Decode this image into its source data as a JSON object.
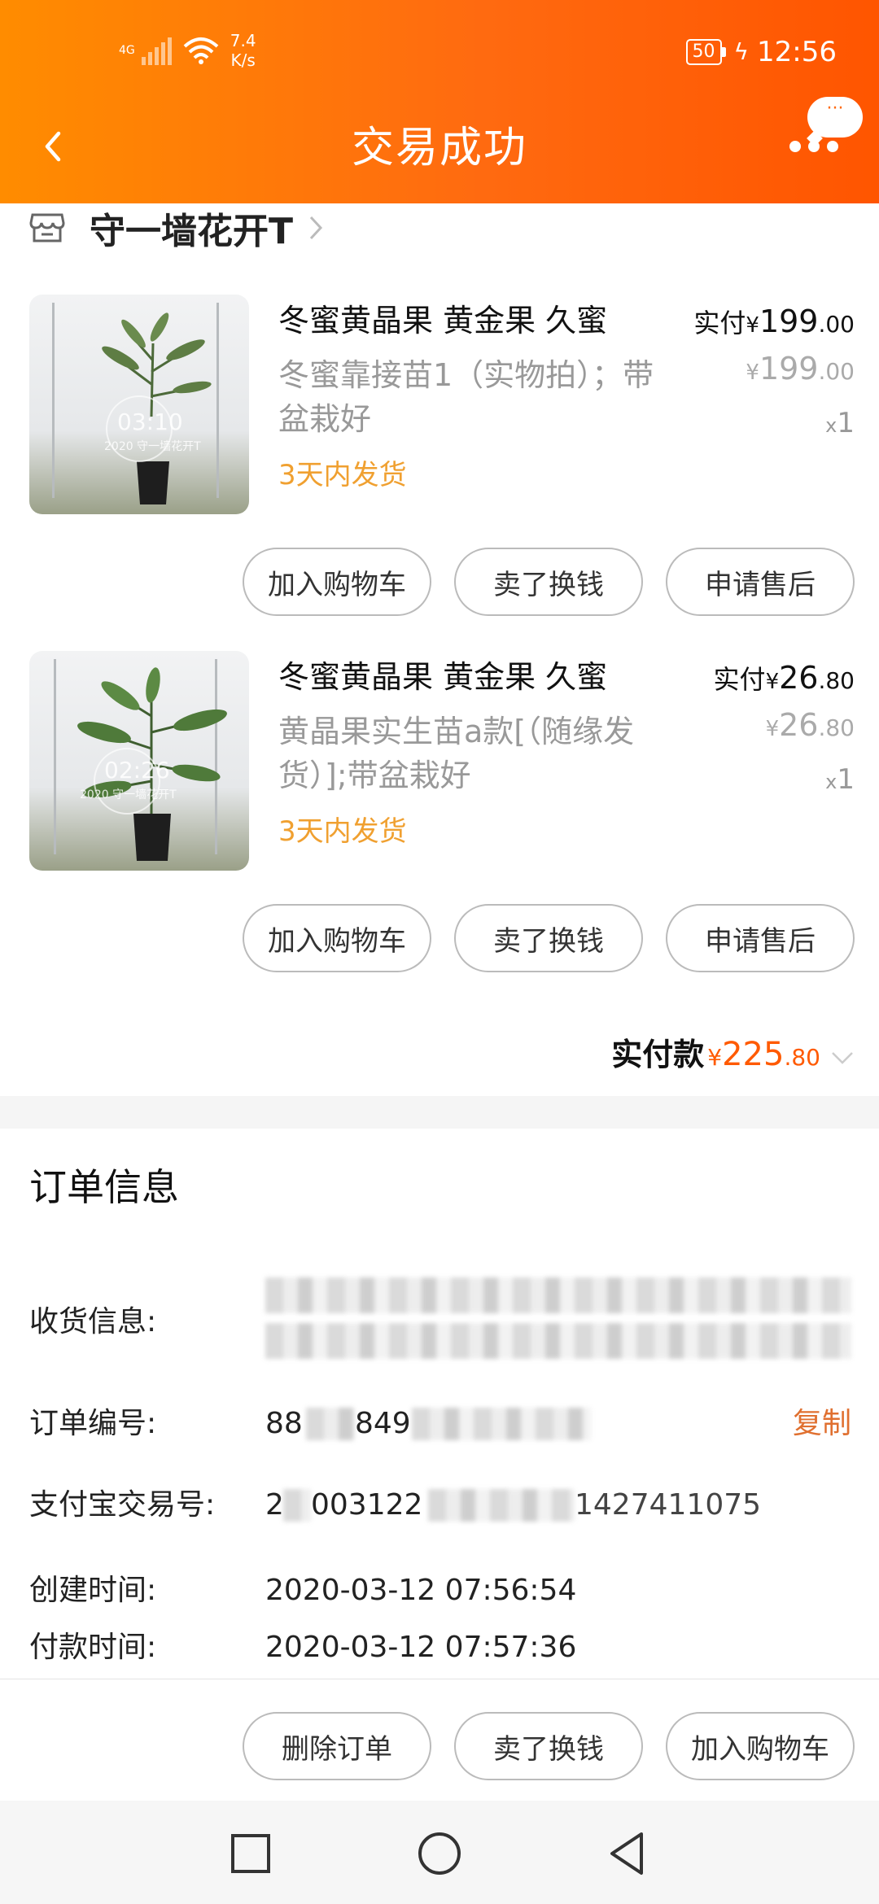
{
  "status_bar": {
    "network": "4G",
    "speed_value": "7.4",
    "speed_unit": "K/s",
    "battery": "50",
    "time": "12:56"
  },
  "header": {
    "title": "交易成功",
    "more_bubble": "···"
  },
  "shop": {
    "name": "守一墙花开T"
  },
  "items": [
    {
      "title": "冬蜜黄晶果 黄金果 久蜜",
      "sku": "冬蜜靠接苗1（实物拍）；带盆栽好",
      "ship": "3天内发货",
      "paid_label": "实付",
      "currency": "¥",
      "paid_int": "199",
      "paid_dec": ".00",
      "orig_int": "199",
      "orig_dec": ".00",
      "qty_prefix": "x",
      "qty": "1",
      "photo_stamp": "03:10",
      "photo_caption": "2020 守一墙花开T"
    },
    {
      "title": "冬蜜黄晶果 黄金果 久蜜",
      "sku": "黄晶果实生苗a款[（随缘发货）];带盆栽好",
      "ship": "3天内发货",
      "paid_label": "实付",
      "currency": "¥",
      "paid_int": "26",
      "paid_dec": ".80",
      "orig_int": "26",
      "orig_dec": ".80",
      "qty_prefix": "x",
      "qty": "1",
      "photo_stamp": "02:26",
      "photo_caption": "2020 守一墙花开T"
    }
  ],
  "item_buttons": [
    "加入购物车",
    "卖了换钱",
    "申请售后"
  ],
  "total": {
    "label": "实付款",
    "currency": "¥",
    "int": "225",
    "dec": ".80"
  },
  "order_info": {
    "title": "订单信息",
    "receiver_label": "收货信息:",
    "order_no_label": "订单编号:",
    "order_no_visible_start": "88",
    "order_no_visible_mid": "849",
    "copy_label": "复制",
    "alipay_label": "支付宝交易号:",
    "alipay_visible_start": "2",
    "alipay_visible_mid": "003122",
    "alipay_visible_end": "1427411075",
    "created_label": "创建时间:",
    "created_value": "2020-03-12 07:56:54",
    "paid_time_label": "付款时间:",
    "paid_time_value": "2020-03-12 07:57:36"
  },
  "bottom_actions": [
    "删除订单",
    "卖了换钱",
    "加入购物车"
  ],
  "colors": {
    "header_gradient_start": "#ff8c00",
    "header_gradient_end": "#ff5500",
    "accent_price": "#ff5a00",
    "ship_text": "#f0a030",
    "copy_link": "#e07030"
  }
}
